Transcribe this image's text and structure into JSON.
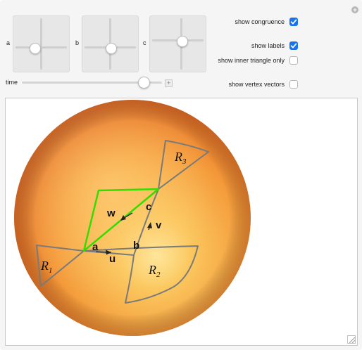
{
  "controls": {
    "pad_a_label": "a",
    "pad_b_label": "b",
    "pad_c_label": "c",
    "time_label": "time",
    "time_value_fraction": 0.87
  },
  "options": {
    "show_congruence": {
      "label": "show congruence",
      "checked": true
    },
    "show_labels": {
      "label": "show labels",
      "checked": true
    },
    "show_inner_triangle_only": {
      "label": "show inner triangle only",
      "checked": false
    },
    "show_vertex_vectors": {
      "label": "show vertex vectors",
      "checked": false
    }
  },
  "scene": {
    "sphere_color": "#f39a3a",
    "inner_triangle_color": "#33dd00",
    "region_outline_color": "#777777",
    "labels": {
      "R1": "R",
      "R1_sub": "1",
      "R2": "R",
      "R2_sub": "2",
      "R3": "R",
      "R3_sub": "3",
      "a": "a",
      "b": "b",
      "c": "c",
      "u": "u",
      "v": "v",
      "w": "w"
    }
  }
}
